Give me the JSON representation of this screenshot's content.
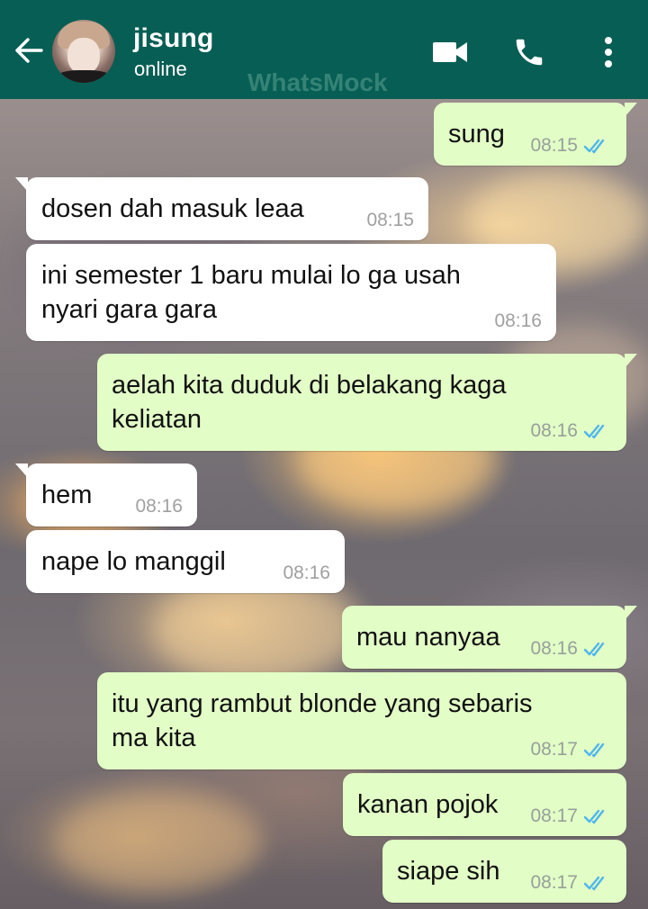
{
  "header": {
    "contact_name": "jisung",
    "status": "online",
    "watermark": "WhatsMock",
    "back_icon": "arrow-left-icon",
    "video_icon": "video-camera-icon",
    "call_icon": "phone-icon",
    "menu_icon": "more-vertical-icon",
    "bar_color": "#075e54"
  },
  "colors": {
    "incoming_bubble": "#ffffff",
    "outgoing_bubble": "#e2fdc6",
    "read_ticks": "#4fb6ec"
  },
  "messages": [
    {
      "direction": "out",
      "lines": [
        "sung"
      ],
      "time": "08:15",
      "status": "read"
    },
    {
      "direction": "in",
      "lines": [
        "dosen dah masuk leaa"
      ],
      "time": "08:15"
    },
    {
      "direction": "in",
      "lines": [
        "ini semester 1 baru mulai lo ga usah",
        "nyari gara gara"
      ],
      "time": "08:16"
    },
    {
      "direction": "out",
      "lines": [
        "aelah kita duduk di belakang kaga",
        "keliatan"
      ],
      "time": "08:16",
      "status": "read"
    },
    {
      "direction": "in",
      "lines": [
        "hem"
      ],
      "time": "08:16"
    },
    {
      "direction": "in",
      "lines": [
        "nape lo manggil"
      ],
      "time": "08:16"
    },
    {
      "direction": "out",
      "lines": [
        "mau nanyaa"
      ],
      "time": "08:16",
      "status": "read"
    },
    {
      "direction": "out",
      "lines": [
        "itu yang rambut blonde yang sebaris",
        "ma kita"
      ],
      "time": "08:17",
      "status": "read"
    },
    {
      "direction": "out",
      "lines": [
        "kanan pojok"
      ],
      "time": "08:17",
      "status": "read"
    },
    {
      "direction": "out",
      "lines": [
        "siape sih"
      ],
      "time": "08:17",
      "status": "read"
    }
  ]
}
